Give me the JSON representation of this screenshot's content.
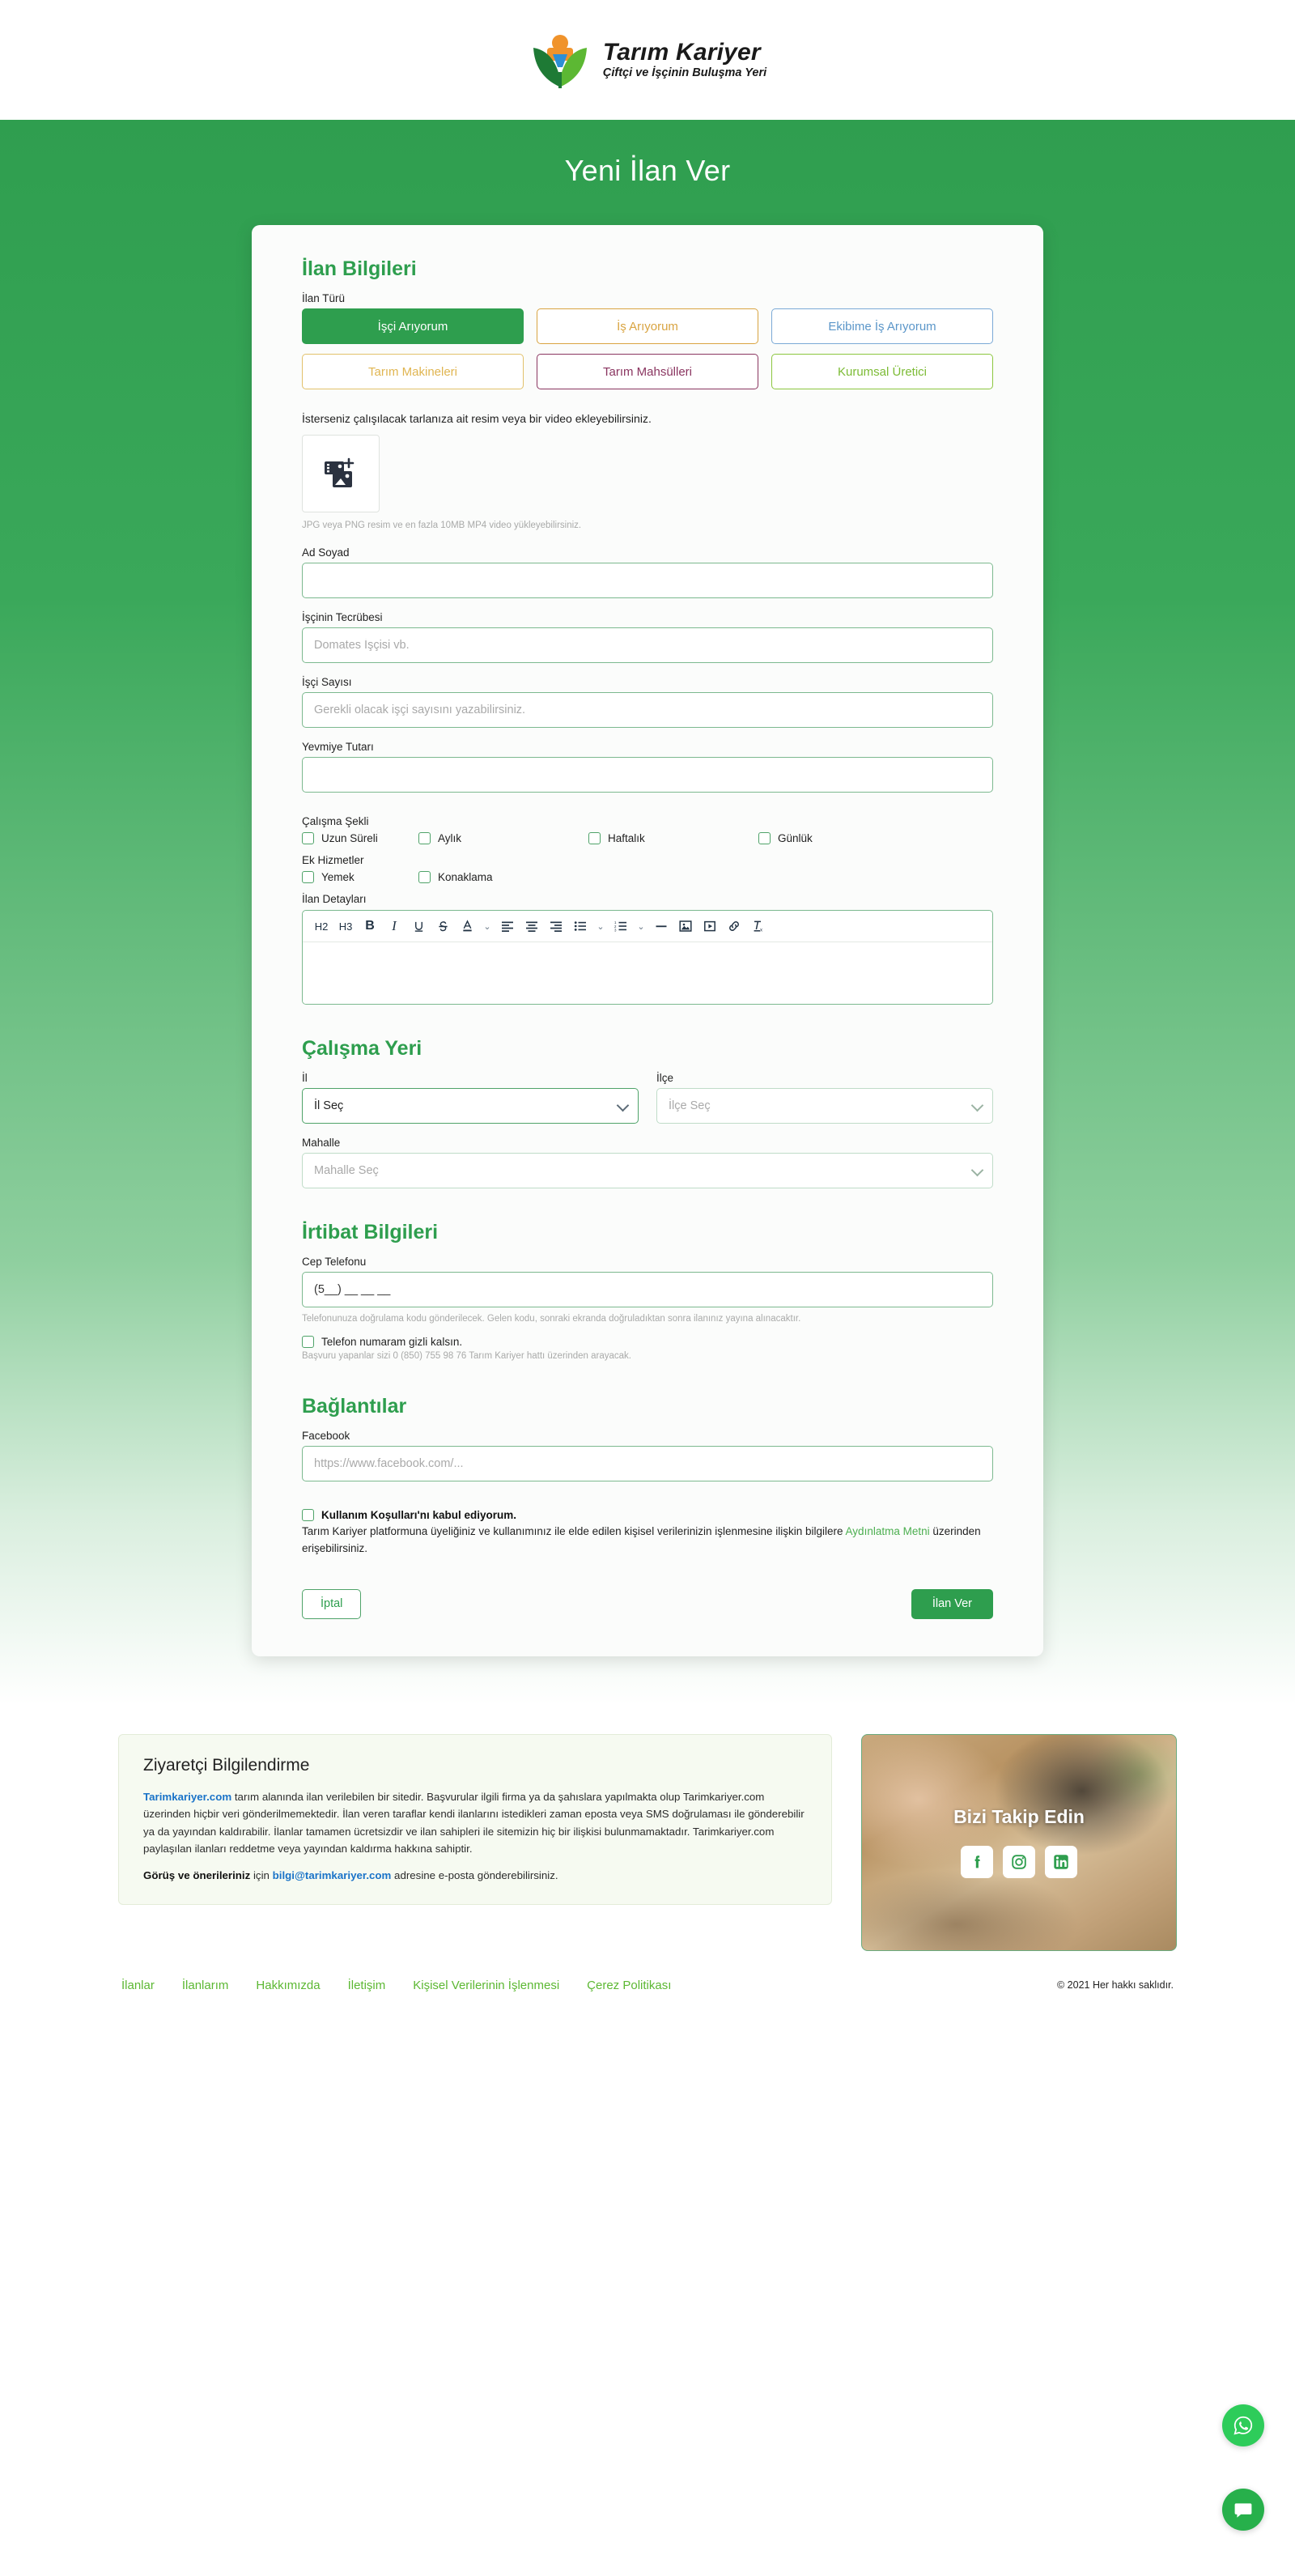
{
  "brand": {
    "name": "Tarım Kariyer",
    "tagline": "Çiftçi ve İşçinin Buluşma Yeri"
  },
  "hero": {
    "title": "Yeni İlan Ver"
  },
  "form": {
    "section_listing": "İlan Bilgileri",
    "type_label": "İlan Türü",
    "types": [
      {
        "label": "İşçi Arıyorum",
        "state": "active"
      },
      {
        "label": "İş Arıyorum",
        "state": "job"
      },
      {
        "label": "Ekibime İş Arıyorum",
        "state": "team"
      },
      {
        "label": "Tarım Makineleri",
        "state": "machine"
      },
      {
        "label": "Tarım Mahsülleri",
        "state": "crop"
      },
      {
        "label": "Kurumsal Üretici",
        "state": "corp"
      }
    ],
    "upload_note": "İsterseniz çalışılacak tarlanıza ait resim veya bir video ekleyebilirsiniz.",
    "upload_hint": "JPG veya PNG resim ve en fazla 10MB MP4 video yükleyebilirsiniz.",
    "fullname_label": "Ad Soyad",
    "fullname_value": "",
    "fullname_placeholder": "",
    "experience_label": "İşçinin Tecrübesi",
    "experience_placeholder": "Domates İşçisi vb.",
    "worker_count_label": "İşçi Sayısı",
    "worker_count_placeholder": "Gerekli olacak işçi sayısını yazabilirsiniz.",
    "wage_label": "Yevmiye Tutarı",
    "wage_placeholder": "",
    "work_type_label": "Çalışma Şekli",
    "work_types": [
      "Uzun Süreli",
      "Aylık",
      "Haftalık",
      "Günlük"
    ],
    "extra_services_label": "Ek Hizmetler",
    "extra_services": [
      "Yemek",
      "Konaklama"
    ],
    "details_label": "İlan Detayları",
    "toolbar": [
      {
        "icon": "heading-2-icon",
        "label": "H2"
      },
      {
        "icon": "heading-3-icon",
        "label": "H3"
      },
      {
        "icon": "bold-icon",
        "label": "B"
      },
      {
        "icon": "italic-icon",
        "label": "I"
      },
      {
        "icon": "underline-icon",
        "label": "U"
      },
      {
        "icon": "strikethrough-icon",
        "label": "S"
      },
      {
        "icon": "text-color-icon",
        "label": "A"
      },
      {
        "icon": "chevron-down-icon",
        "label": "⌄"
      },
      {
        "icon": "align-left-icon",
        "label": ""
      },
      {
        "icon": "align-center-icon",
        "label": ""
      },
      {
        "icon": "align-right-icon",
        "label": ""
      },
      {
        "icon": "bullet-list-icon",
        "label": ""
      },
      {
        "icon": "chevron-down-icon",
        "label": "⌄"
      },
      {
        "icon": "numbered-list-icon",
        "label": ""
      },
      {
        "icon": "chevron-down-icon",
        "label": "⌄"
      },
      {
        "icon": "horizontal-rule-icon",
        "label": "—"
      },
      {
        "icon": "insert-image-icon",
        "label": ""
      },
      {
        "icon": "insert-video-icon",
        "label": ""
      },
      {
        "icon": "insert-link-icon",
        "label": ""
      },
      {
        "icon": "clear-format-icon",
        "label": ""
      }
    ],
    "details_value": ""
  },
  "workplace": {
    "section_title": "Çalışma Yeri",
    "province_label": "İl",
    "province_value": "İl Seç",
    "district_label": "İlçe",
    "district_placeholder": "İlçe Seç",
    "neighbourhood_label": "Mahalle",
    "neighbourhood_placeholder": "Mahalle Seç"
  },
  "contact": {
    "section_title": "İrtibat Bilgileri",
    "phone_label": "Cep Telefonu",
    "phone_value": "(5__) __ __ __",
    "phone_helper": "Telefonunuza doğrulama kodu gönderilecek. Gelen kodu, sonraki ekranda doğruladıktan sonra ilanınız yayına alınacaktır.",
    "hide_phone_label": "Telefon numaram gizli kalsın.",
    "hide_phone_helper": "Başvuru yapanlar sizi 0 (850) 755 98 76 Tarım Kariyer hattı üzerinden arayacak."
  },
  "links": {
    "section_title": "Bağlantılar",
    "facebook_label": "Facebook",
    "facebook_placeholder": "https://www.facebook.com/..."
  },
  "terms": {
    "checkbox_label": "Kullanım Koşulları'nı kabul ediyorum.",
    "text_before": "Tarım Kariyer platformuna üyeliğiniz ve kullanımınız ile elde edilen kişisel verilerinizin işlenmesine ilişkin bilgilere ",
    "link_text": "Aydınlatma Metni",
    "text_after": " üzerinden erişebilirsiniz."
  },
  "actions": {
    "cancel_label": "İptal",
    "submit_label": "İlan Ver"
  },
  "info_box": {
    "title": "Ziyaretçi Bilgilendirme",
    "link_site": "Tarimkariyer.com",
    "paragraph": " tarım alanında ilan verilebilen bir sitedir. Başvurular ilgili firma ya da şahıslara yapılmakta olup Tarimkariyer.com üzerinden hiçbir veri gönderilmemektedir. İlan veren taraflar kendi ilanlarını istedikleri zaman eposta veya SMS doğrulaması ile gönderebilir ya da yayından kaldırabilir. İlanlar tamamen ücretsizdir ve ilan sahipleri ile sitemizin hiç bir ilişkisi bulunmamaktadır. Tarimkariyer.com paylaşılan ilanları reddetme veya yayından kaldırma hakkına sahiptir.",
    "foot_bold": "Görüş ve önerileriniz",
    "foot_mid": " için ",
    "foot_email": "bilgi@tarimkariyer.com",
    "foot_end": " adresine e-posta gönderebilirsiniz."
  },
  "follow": {
    "title": "Bizi Takip Edin",
    "socials": [
      "facebook-icon",
      "instagram-icon",
      "linkedin-icon"
    ]
  },
  "footer": {
    "links": [
      "İlanlar",
      "İlanlarım",
      "Hakkımızda",
      "İletişim",
      "Kişisel Verilerinin İşlenmesi",
      "Çerez Politikası"
    ],
    "copyright": "© 2021 Her hakkı saklıdır."
  },
  "fabs": [
    {
      "icon": "whatsapp-icon"
    },
    {
      "icon": "chat-bubble-icon"
    }
  ],
  "colors": {
    "brand_green": "#2e9e4e",
    "link_green": "#5cb833",
    "link_blue": "#1a73c8"
  }
}
